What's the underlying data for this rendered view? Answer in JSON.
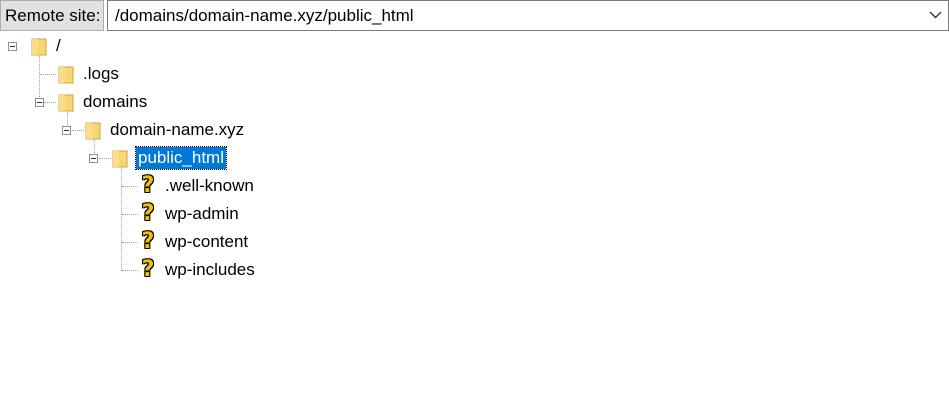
{
  "toolbar": {
    "remote_site_label": "Remote site:",
    "path_value": "/domains/domain-name.xyz/public_html"
  },
  "tree": {
    "root": "/",
    "logs": ".logs",
    "domains": "domains",
    "domain": "domain-name.xyz",
    "public_html": "public_html",
    "well_known": ".well-known",
    "wp_admin": "wp-admin",
    "wp_content": "wp-content",
    "wp_includes": "wp-includes"
  },
  "icons": {
    "folder": "folder-icon",
    "unknown": "question-mark-icon",
    "collapse": "collapse-toggle-icon"
  },
  "colors": {
    "selection": "#0078d7",
    "folder": "#f7d774"
  }
}
